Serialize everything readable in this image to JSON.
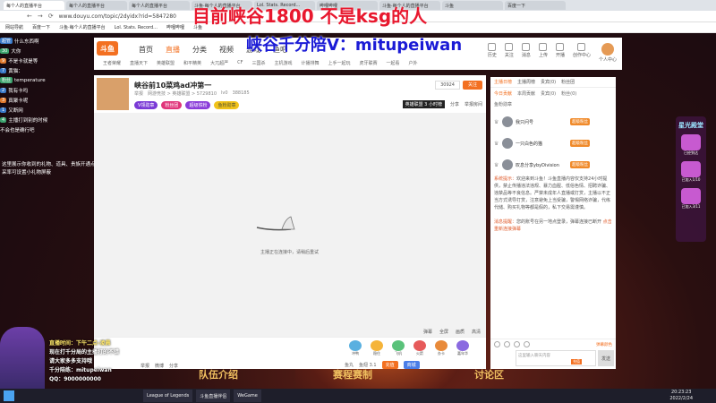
{
  "browser": {
    "tabs": [
      "每个人的直播平台",
      "每个人的直播平台",
      "每个人的直播平台",
      "斗鱼·每个人的直播平台",
      "Lol. Stats. Record...",
      "哔哩哔哩",
      "斗鱼·每个人的直播平台",
      "斗鱼",
      "百度一下"
    ],
    "url": "www.douyu.com/topic/2dyidx?rid=5847280",
    "bookmarks": [
      "网站导航",
      "百度一下",
      "斗鱼·每个人的直播平台",
      "Lol. Stats. Record...",
      "哔哩哔哩",
      "斗鱼"
    ]
  },
  "overlay": {
    "line1": "目前峡谷1800 不是ksg的人",
    "line2": "峡谷千分陪V：mitupeiwan"
  },
  "left_chat": {
    "messages": [
      {
        "badge": "超管",
        "text": "什么东西啊"
      },
      {
        "badge": "30",
        "text": "大你"
      },
      {
        "badge": "9",
        "text": "不是卡就是等"
      },
      {
        "badge": "7",
        "text": "黄猫："
      },
      {
        "badge": "粉丝",
        "text": "temperature"
      },
      {
        "badge": "2",
        "text": "我有卡吗"
      },
      {
        "badge": "3",
        "text": "真聚卡呢"
      },
      {
        "badge": "1",
        "text": "又断网"
      },
      {
        "badge": "4",
        "text": "主播打到别的时候"
      },
      {
        "badge": "",
        "text": "不会也是确行吧"
      }
    ],
    "note": "这里展示你收到的礼物、道具、贵族开通点采率可设置小礼物屏蔽"
  },
  "site": {
    "logo": "斗鱼",
    "nav": [
      "首页",
      "直播",
      "分类",
      "视频",
      "游戏",
      "鱼吧"
    ],
    "nav_active": "直播",
    "subnav": [
      "王者荣耀",
      "直播天下",
      "英雄联盟",
      "和平精英",
      "大兀超严",
      "CF",
      "三国杀",
      "主机游戏",
      "计播排舞",
      "上手一起玩",
      "虎牙联赛",
      "一起看",
      "户外"
    ],
    "icons": [
      "历史",
      "关注",
      "消息",
      "上传",
      "开播",
      "创作中心",
      "个人中心"
    ]
  },
  "room": {
    "title": "峡谷前10菜鸡ad冲第一",
    "meta": [
      "举报",
      "网游竞技 > 英雄联盟 > 5729810"
    ],
    "rank_level": "lv0",
    "fans_count": "388185",
    "tags": [
      "V领勋章",
      "粉丝团",
      "超级铁粉",
      "鱼粉勋章"
    ],
    "follow_count": "30924",
    "follow_label": "关注",
    "rank_badge": "英雄联盟 3 小时榜",
    "share_label": "分享",
    "report_label": "举报房间"
  },
  "video": {
    "loading": "主播正在连接中，请稍后重试",
    "controls": [
      "弹幕",
      "全屏",
      "画质",
      "高清"
    ]
  },
  "giftbar": {
    "gifts": [
      "冲鸭",
      "稳住",
      "飞机",
      "火箭",
      "办卡",
      "嘉年华"
    ],
    "bottom": [
      "鱼丸",
      "鱼翅 3.1",
      "充值",
      "商城"
    ],
    "left_info": [
      "举报",
      "微博",
      "分享"
    ]
  },
  "panel": {
    "tabs": [
      "主播日榜",
      "主播周榜",
      "贵宾(0)",
      "粉丝团"
    ],
    "subtabs": [
      "今日贡献",
      "本周贡献",
      "贵宾(0)",
      "粉丝(0)"
    ],
    "fan_label": "鱼粉勋章",
    "rank_list": [
      {
        "name": "我只问号",
        "badge": "超级粉丝"
      },
      {
        "name": "一只白色的猫",
        "badge": "超级粉丝"
      },
      {
        "name": "叹息分享ybyDivision",
        "badge": "超级粉丝"
      }
    ],
    "notice_sys": "系统提示：",
    "notice_text": "欢迎来到斗鱼！斗鱼直播内容仅支持24小时提供，禁止传播违法违规、暴力血腥、低俗色情、招聘诈骗、违禁品等不良信息。严禁未成年人直播或打赏，主播以不正当方式诱导打赏，注意避免上当受骗，警惕网络诈骗，代练代储、购买礼物等都是假的，私下交易需谨慎。",
    "notice_warn": "消息提醒：",
    "notice_warn_text": "您的账号在另一地点登录，弹幕连接已断开",
    "notice_link": "点击重新连接弹幕",
    "input_placeholder": "这里输入聊天内容",
    "send_label": "发送",
    "recharge": "充值",
    "color_label": "弹幕颜色"
  },
  "side": {
    "title": "星光殿堂",
    "items": [
      "已经到达",
      "已加入1/10",
      "已加入3/11"
    ]
  },
  "game_labels": [
    "队伍介绍",
    "赛程赛制",
    "讨论区"
  ],
  "stream_chat": [
    "直播时间：下午二点-凌晨",
    "现在打千分局的主播打的不错",
    "请大家多多支持哦",
    "千分陪练：mitupeiwan",
    "QQ：9000000000"
  ],
  "taskbar": {
    "items": [
      "League of Legends",
      "斗鱼直播伴侣",
      "WeGame"
    ],
    "time": "20:23:23",
    "date": "2022/2/24"
  }
}
